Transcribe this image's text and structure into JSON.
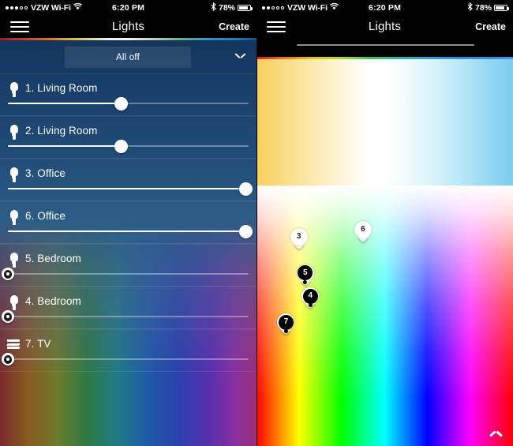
{
  "statusbar": {
    "carrier": "VZW Wi-Fi",
    "time": "6:20 PM",
    "battery_pct": "78%",
    "signal_filled": 3,
    "signal_hollow": 2,
    "wifi_icon": "wifi-icon",
    "bluetooth_icon": "bluetooth-icon",
    "battery_icon": "battery-icon"
  },
  "navbar": {
    "title": "Lights",
    "create_label": "Create",
    "menu_icon": "hamburger-menu-icon"
  },
  "left_panel": {
    "all_off_label": "All off",
    "collapse_icon": "chevron-down-icon",
    "lights": [
      {
        "name": "1. Living Room",
        "icon": "bulb-icon",
        "value": 47,
        "state": "on"
      },
      {
        "name": "2. Living Room",
        "icon": "bulb-icon",
        "value": 47,
        "state": "on"
      },
      {
        "name": "3. Office",
        "icon": "bulb-icon",
        "value": 99,
        "state": "on"
      },
      {
        "name": "6. Office",
        "icon": "bulb-icon",
        "value": 99,
        "state": "on"
      },
      {
        "name": "5. Bedroom",
        "icon": "bulb-icon",
        "value": 0,
        "state": "off"
      },
      {
        "name": "4. Bedroom",
        "icon": "bulb-icon",
        "value": 0,
        "state": "off"
      },
      {
        "name": "7. TV",
        "icon": "lightstrip-icon",
        "value": 0,
        "state": "off"
      }
    ]
  },
  "right_panel": {
    "drag_handle": "sheet-drag-handle",
    "temperature_strip": "white-balance-gradient",
    "color_picker": "hue-saturation-gradient",
    "expand_icon": "chevron-up-icon",
    "markers": [
      {
        "label": "3",
        "x": 16.5,
        "y": 23.5,
        "state": "on"
      },
      {
        "label": "6",
        "x": 41.5,
        "y": 21.0,
        "state": "on"
      },
      {
        "label": "5",
        "x": 19.0,
        "y": 37.5,
        "state": "off"
      },
      {
        "label": "4",
        "x": 21.0,
        "y": 46.5,
        "state": "off"
      },
      {
        "label": "7",
        "x": 11.5,
        "y": 56.5,
        "state": "off"
      }
    ]
  },
  "colors": {
    "nav_bg": "#000000",
    "panel_bg_top": "#14355c",
    "accent_white": "#ffffff",
    "marker_off": "#000000"
  }
}
